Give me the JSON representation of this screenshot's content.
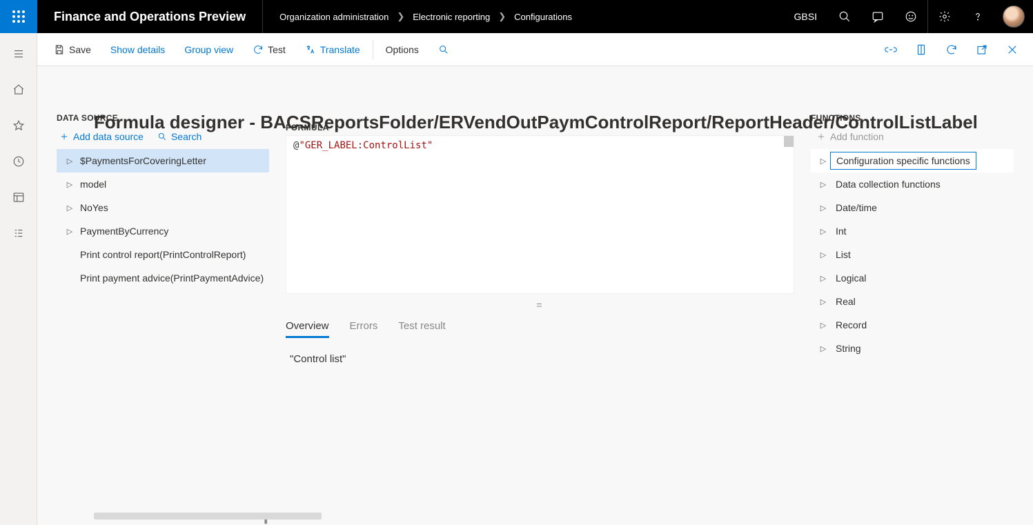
{
  "app": {
    "title": "Finance and Operations Preview"
  },
  "breadcrumb": {
    "a": "Organization administration",
    "b": "Electronic reporting",
    "c": "Configurations"
  },
  "company": "GBSI",
  "cmdbar": {
    "save": "Save",
    "show_details": "Show details",
    "group_view": "Group view",
    "test": "Test",
    "translate": "Translate",
    "options": "Options"
  },
  "page": {
    "title": "Formula designer - BACSReportsFolder/ERVendOutPaymControlReport/ReportHeader/ControlListLabel"
  },
  "data_source": {
    "heading": "DATA SOURCE",
    "add": "Add data source",
    "search": "Search",
    "items": [
      {
        "label": "$PaymentsForCoveringLetter",
        "expandable": true,
        "selected": true
      },
      {
        "label": "model",
        "expandable": true,
        "selected": false
      },
      {
        "label": "NoYes",
        "expandable": true,
        "selected": false
      },
      {
        "label": "PaymentByCurrency",
        "expandable": true,
        "selected": false
      },
      {
        "label": "Print control report(PrintControlReport)",
        "expandable": false,
        "selected": false
      },
      {
        "label": "Print payment advice(PrintPaymentAdvice)",
        "expandable": false,
        "selected": false
      }
    ]
  },
  "formula": {
    "heading": "FORMULA",
    "op": "@",
    "str": "\"GER_LABEL:ControlList\""
  },
  "tabs": {
    "overview": "Overview",
    "errors": "Errors",
    "test_result": "Test result"
  },
  "overview_value": "\"Control list\"",
  "functions": {
    "heading": "FUNCTIONS",
    "add": "Add function",
    "items": [
      {
        "label": "Configuration specific functions",
        "selected": true
      },
      {
        "label": "Data collection functions",
        "selected": false
      },
      {
        "label": "Date/time",
        "selected": false
      },
      {
        "label": "Int",
        "selected": false
      },
      {
        "label": "List",
        "selected": false
      },
      {
        "label": "Logical",
        "selected": false
      },
      {
        "label": "Real",
        "selected": false
      },
      {
        "label": "Record",
        "selected": false
      },
      {
        "label": "String",
        "selected": false
      }
    ]
  }
}
